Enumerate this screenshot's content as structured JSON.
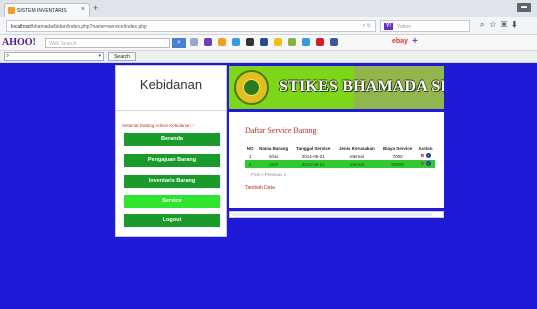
{
  "browser": {
    "tab_title": "SISTEM INVENTARIS",
    "tab_close": "×",
    "new_tab": "+",
    "url_host": "localhost",
    "url_path": "/bhamada/bidan/index.php?name=service/index.php",
    "yahoo_search_placeholder": "Yahoo",
    "toolbar_logo": "AHOO!",
    "toolbar_search_placeholder": "Web Search",
    "ebay_label": "ebay",
    "find_button": "Search",
    "window_control": "▬"
  },
  "sidebar": {
    "brand": "Kebidanan",
    "welcome": "Selamat Datang Admin Kebidanan :-",
    "menu": [
      {
        "label": "Beranda",
        "active": false
      },
      {
        "label": "Pengajuan Barang",
        "active": false
      },
      {
        "label": "Inventaris Barang",
        "active": false
      },
      {
        "label": "Service",
        "active": true
      },
      {
        "label": "Logout",
        "active": false
      }
    ]
  },
  "banner": {
    "title": "STIKES BHAMADA SLAWI"
  },
  "content": {
    "title": "Daftar Service Barang",
    "columns": [
      "NO",
      "Nama Barang",
      "Tanggal Service",
      "Jenis Kerusakan",
      "Biaya Service",
      "Action"
    ],
    "rows": [
      {
        "no": "1",
        "nama": "infus",
        "tanggal": "2014-06-21",
        "jenis": "eternal",
        "biaya": "7000"
      },
      {
        "no": "2",
        "nama": "infal",
        "tanggal": "2014-06-21",
        "jenis": "eternal",
        "biaya": "50000"
      }
    ],
    "pager": "First < Previous 1",
    "add_link": "Tambah Data"
  }
}
